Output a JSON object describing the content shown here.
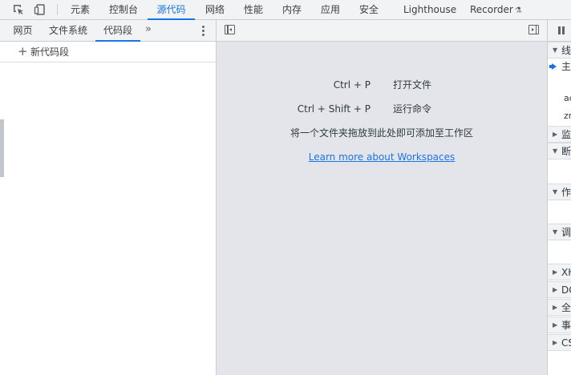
{
  "main_tabs": [
    {
      "label": "元素"
    },
    {
      "label": "控制台"
    },
    {
      "label": "源代码",
      "active": true
    },
    {
      "label": "网络"
    },
    {
      "label": "性能"
    },
    {
      "label": "内存"
    },
    {
      "label": "应用"
    },
    {
      "label": "安全"
    },
    {
      "label": "Lighthouse"
    },
    {
      "label": "Recorder"
    }
  ],
  "toolbar_icons": [
    "inspect-element-icon",
    "device-toolbar-icon",
    "experimental-flask-icon"
  ],
  "navigator": {
    "tabs": [
      {
        "label": "网页"
      },
      {
        "label": "文件系统"
      },
      {
        "label": "代码段",
        "active": true
      }
    ],
    "more_glyph": "»",
    "new_snippet": {
      "icon": "+",
      "label": "新代码段"
    }
  },
  "editor": {
    "shortcuts": [
      {
        "keys": "Ctrl + P",
        "desc": "打开文件"
      },
      {
        "keys": "Ctrl + Shift + P",
        "desc": "运行命令"
      }
    ],
    "drop_hint": "将一个文件夹拖放到此处即可添加至工作区",
    "learn_link": "Learn more about Workspaces"
  },
  "debugger": {
    "sections": [
      {
        "label": "线",
        "expanded": true
      },
      {
        "label": "主",
        "kind": "thread"
      },
      {
        "label": "ac",
        "kind": "item"
      },
      {
        "label": "zr",
        "kind": "item"
      },
      {
        "label": "监",
        "expanded": false
      },
      {
        "label": "断",
        "expanded": true
      },
      {
        "label": "作",
        "expanded": true
      },
      {
        "label": "调",
        "expanded": true
      },
      {
        "label": "XH",
        "expanded": false
      },
      {
        "label": "DC",
        "expanded": false
      },
      {
        "label": "全",
        "expanded": false
      },
      {
        "label": "事",
        "expanded": false
      },
      {
        "label": "CS",
        "expanded": false
      }
    ]
  }
}
